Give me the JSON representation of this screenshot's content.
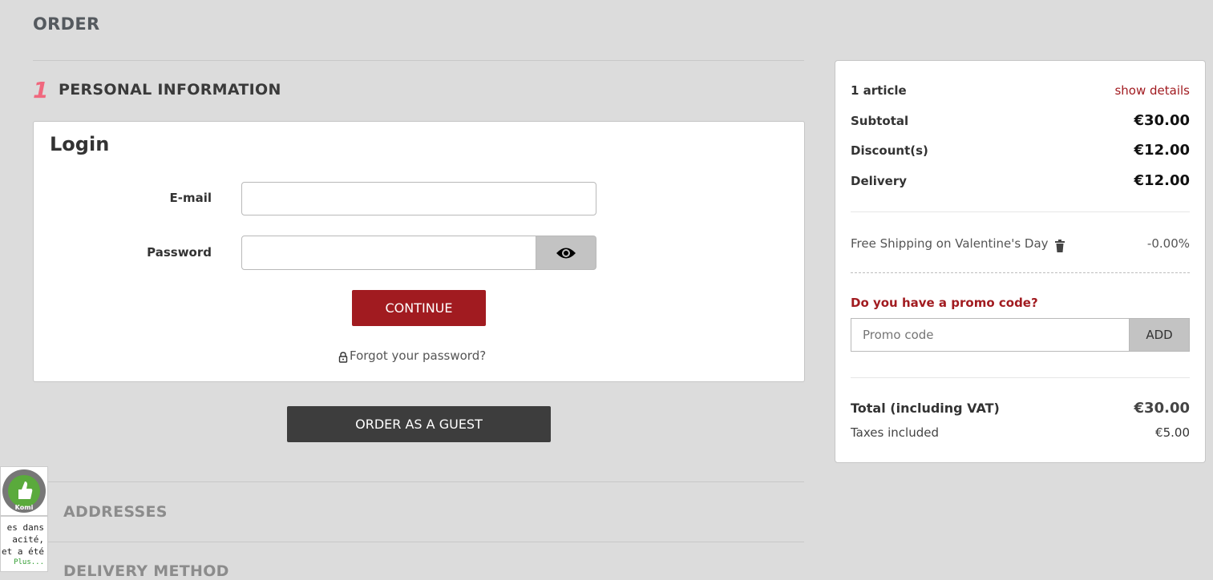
{
  "page": {
    "title": "ORDER"
  },
  "steps": {
    "personal": {
      "number": "1",
      "title": "PERSONAL INFORMATION"
    },
    "addresses": {
      "title": "ADDRESSES"
    },
    "delivery": {
      "title": "DELIVERY METHOD"
    }
  },
  "login": {
    "title": "Login",
    "email_label": "E-mail",
    "email_value": "",
    "email_placeholder": "",
    "password_label": "Password",
    "password_value": "",
    "password_placeholder": "",
    "continue_label": "CONTINUE",
    "forgot_label": "Forgot your password?"
  },
  "guest": {
    "label": "ORDER AS A GUEST"
  },
  "summary": {
    "articles": "1 article",
    "show_details": "show details",
    "subtotal_label": "Subtotal",
    "subtotal_value": "€30.00",
    "discount_label": "Discount(s)",
    "discount_value": "€12.00",
    "delivery_label": "Delivery",
    "delivery_value": "€12.00",
    "voucher_name": "Free Shipping on Valentine's Day",
    "voucher_value": "-0.00%",
    "promo_question": "Do you have a promo code?",
    "promo_placeholder": "Promo code",
    "promo_add": "ADD",
    "total_label": "Total (including VAT)",
    "total_value": "€30.00",
    "taxes_label": "Taxes included",
    "taxes_value": "€5.00"
  },
  "badge": {
    "ring_text": "Komi",
    "lines": [
      "es dans",
      "acité,",
      "et a été"
    ],
    "more": "Plus..."
  },
  "colors": {
    "accent": "#a11b20",
    "step_number": "#f0687e",
    "guest_button": "#3d3d3d",
    "background": "#dcdcdc"
  }
}
